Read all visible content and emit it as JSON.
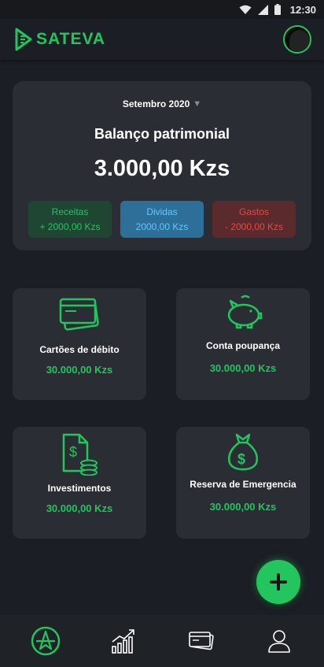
{
  "status_bar": {
    "time": "12:30",
    "icons": [
      "wifi-icon",
      "signal-icon",
      "battery-icon"
    ]
  },
  "header": {
    "brand": "SATEVA",
    "logo_icon": "sateva-logo-icon",
    "avatar_icon": "user-avatar"
  },
  "balance": {
    "month": "Setembro 2020",
    "title": "Balanço patrimonial",
    "value": "3.000,00 Kzs",
    "chips": [
      {
        "label": "Receitas",
        "value": "+ 2000,00 Kzs"
      },
      {
        "label": "Dividas",
        "value": "2000,00 Kzs"
      },
      {
        "label": "Gastos",
        "value": "- 2000,00 Kzs"
      }
    ]
  },
  "accounts": [
    {
      "label": "Cartões de débito",
      "value": "30.000,00 Kzs",
      "icon": "credit-card-icon"
    },
    {
      "label": "Conta poupança",
      "value": "30.000,00 Kzs",
      "icon": "piggy-bank-icon"
    },
    {
      "label": "Investimentos",
      "value": "30.000,00 Kzs",
      "icon": "investment-document-icon"
    },
    {
      "label": "Reserva de Emergencia",
      "value": "30.000,00 Kzs",
      "icon": "money-bag-icon"
    }
  ],
  "fab": {
    "icon": "plus-icon"
  },
  "bottom_nav": [
    {
      "name": "home",
      "icon": "home-logo-icon",
      "active": true
    },
    {
      "name": "stats",
      "icon": "bar-chart-icon",
      "active": false
    },
    {
      "name": "cards",
      "icon": "cards-icon",
      "active": false
    },
    {
      "name": "profile",
      "icon": "user-icon",
      "active": false
    }
  ],
  "colors": {
    "accent": "#22c55e",
    "background": "#1b1e24",
    "card": "#2a2d33",
    "income_bg": "#1f4633",
    "debt_bg": "#2d6f98",
    "debt_text": "#5ec8ff",
    "expense_bg": "#5a2a2c",
    "expense_text": "#ef4444"
  }
}
